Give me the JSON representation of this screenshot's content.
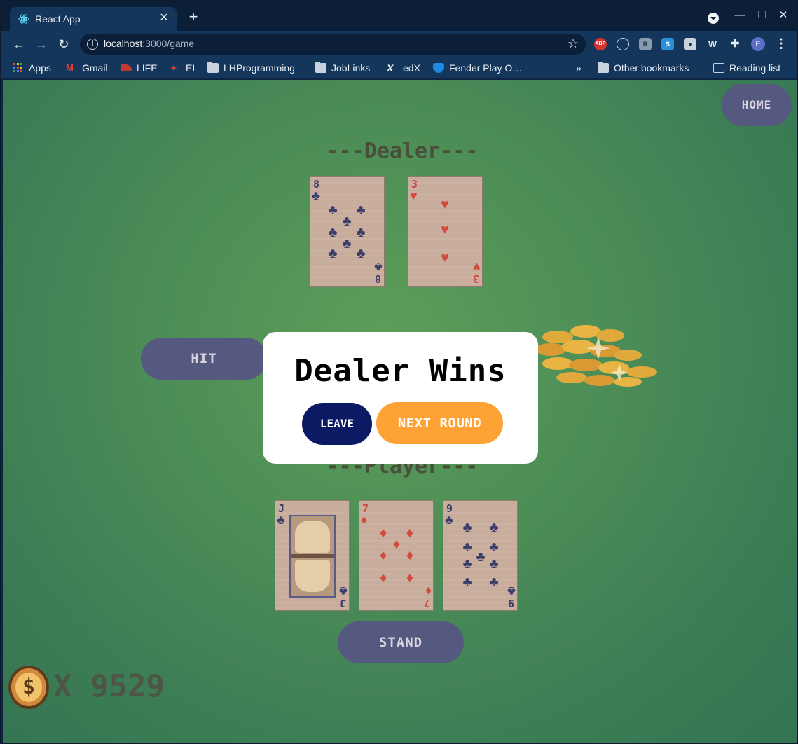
{
  "browser": {
    "tab_title": "React App",
    "tab_close": "✕",
    "new_tab": "+",
    "url_host": "localhost",
    "url_path": ":3000/game",
    "window_controls": [
      "—",
      "☐",
      "✕"
    ],
    "avatar_letter": "E",
    "bookmarks": [
      "Apps",
      "Gmail",
      "LIFE",
      "EI",
      "LHProgramming",
      "JobLinks",
      "edX",
      "Fender Play O…"
    ],
    "bookmarks_more": "»",
    "other_bookmarks": "Other bookmarks",
    "reading_list": "Reading list",
    "extensions": [
      "ABP",
      "globe",
      "R",
      "S",
      "bulb",
      "W",
      "puzzle"
    ]
  },
  "game": {
    "home_label": "HOME",
    "dealer_title": "---Dealer---",
    "player_title": "---Player---",
    "hit_label": "HIT",
    "stand_label": "STAND",
    "dealer_cards": [
      {
        "rank": "8",
        "suit": "♣",
        "color": "black"
      },
      {
        "rank": "3",
        "suit": "♥",
        "color": "red"
      }
    ],
    "player_cards": [
      {
        "rank": "J",
        "suit": "♣",
        "color": "black"
      },
      {
        "rank": "7",
        "suit": "♦",
        "color": "red"
      },
      {
        "rank": "9",
        "suit": "♣",
        "color": "black"
      }
    ],
    "money_prefix": "X",
    "money_value": "9529",
    "coin_symbol": "$"
  },
  "modal": {
    "title": "Dealer Wins",
    "leave_label": "LEAVE",
    "next_round_label": "NEXT ROUND"
  },
  "colors": {
    "table_green": "#4e8f57",
    "button_purple": "#55597f",
    "leave_navy": "#0b1a63",
    "next_orange": "#ffa236"
  }
}
